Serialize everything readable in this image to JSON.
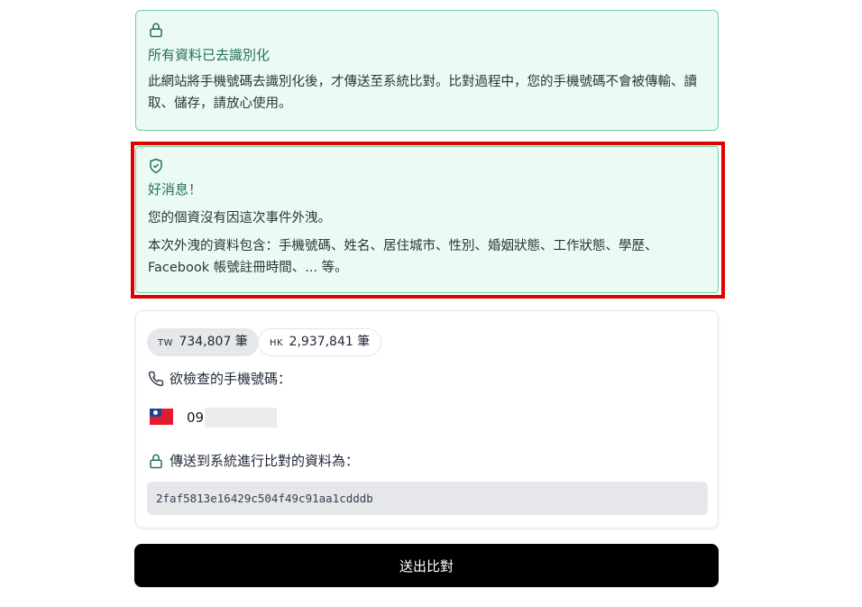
{
  "privacy_notice": {
    "icon": "lock-icon",
    "title": "所有資料已去識別化",
    "body": "此網站將手機號碼去識別化後，才傳送至系統比對。比對過程中，您的手機號碼不會被傳輸、讀取、儲存，請放心使用。"
  },
  "result_notice": {
    "icon": "shield-check-icon",
    "title": "好消息！",
    "line1": "您的個資沒有因這次事件外洩。",
    "line2": "本次外洩的資料包含：手機號碼、姓名、居住城市、性別、婚姻狀態、工作狀態、學歷、Facebook 帳號註冊時間、... 等。"
  },
  "stats": {
    "tw": {
      "code": "TW",
      "count": "734,807 筆"
    },
    "hk": {
      "code": "HK",
      "count": "2,937,841 筆"
    }
  },
  "phone": {
    "label": "欲檢查的手機號碼：",
    "icon": "phone-icon",
    "flag": "taiwan-flag-icon",
    "visible_prefix": "09"
  },
  "hash": {
    "label": "傳送到系統進行比對的資料為：",
    "icon": "lock-icon",
    "value": "2faf5813e16429c504f49c91aa1cdddb"
  },
  "submit_label": "送出比對",
  "colors": {
    "notice_bg": "#ebfbf3",
    "notice_border": "#6fcfa6",
    "notice_title": "#24705a",
    "highlight": "#e00000",
    "button_bg": "#000000"
  }
}
